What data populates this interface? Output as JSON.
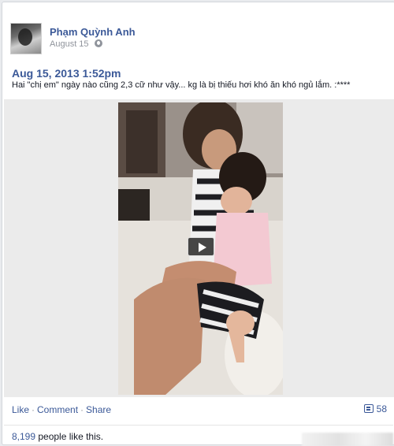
{
  "post": {
    "author": "Phạm Quỳnh Anh",
    "date": "August 15",
    "title": "Aug 15, 2013 1:52pm",
    "text": "Hai \"chị em\" ngày nào cũng 2,3 cữ như vậy... kg là bị thiếu hơi khó ăn khó ngủ lắm. :****"
  },
  "actions": {
    "like": "Like",
    "comment": "Comment",
    "share": "Share",
    "separator": "·",
    "comment_count": "58"
  },
  "likes": {
    "count": "8,199",
    "text": " people like this."
  },
  "icons": {
    "privacy": "globe-icon",
    "comments": "comment-icon",
    "video": "play-icon"
  },
  "colors": {
    "link": "#3b5998",
    "text": "#141823",
    "meta": "#90949c"
  }
}
